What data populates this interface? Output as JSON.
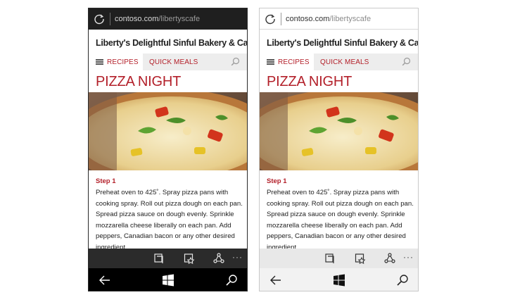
{
  "phones": [
    {
      "theme": "dark",
      "address_bar": {
        "domain": "contoso.com",
        "path": "/libertyscafe"
      },
      "site_title": "Liberty's Delightful Sinful Bakery & Café",
      "nav": {
        "recipes_label": "RECIPES",
        "quick_meals_label": "QUICK MEALS"
      },
      "page_heading": "PIZZA NIGHT",
      "step": {
        "label": "Step 1",
        "body": "Preheat oven to 425˚. Spray pizza pans with cooking spray. Roll out pizza dough on each pan. Spread pizza sauce on dough evenly. Sprinkle mozzarella cheese liberally on each pan. Add peppers, Canadian bacon or any other desired ingredient."
      },
      "app_bar": {
        "more_label": "···"
      }
    },
    {
      "theme": "light",
      "address_bar": {
        "domain": "contoso.com",
        "path": "/libertyscafe"
      },
      "site_title": "Liberty's Delightful Sinful Bakery & Café",
      "nav": {
        "recipes_label": "RECIPES",
        "quick_meals_label": "QUICK MEALS"
      },
      "page_heading": "PIZZA NIGHT",
      "step": {
        "label": "Step 1",
        "body": "Preheat oven to 425˚. Spray pizza pans with cooking spray. Roll out pizza dough on each pan. Spread pizza sauce on dough evenly. Sprinkle mozzarella cheese liberally on each pan. Add peppers, Canadian bacon or any other desired ingredient."
      },
      "app_bar": {
        "more_label": "···"
      }
    }
  ],
  "icons": {
    "refresh": "refresh-icon",
    "search": "search-icon",
    "tabs": "tabs-icon",
    "favorites": "favorites-icon",
    "share": "share-icon",
    "back": "back-arrow-icon",
    "start": "windows-start-icon"
  },
  "colors": {
    "accent": "#b3202a",
    "dark_chrome": "#1f1f1f",
    "light_chrome": "#f2f2f2"
  }
}
